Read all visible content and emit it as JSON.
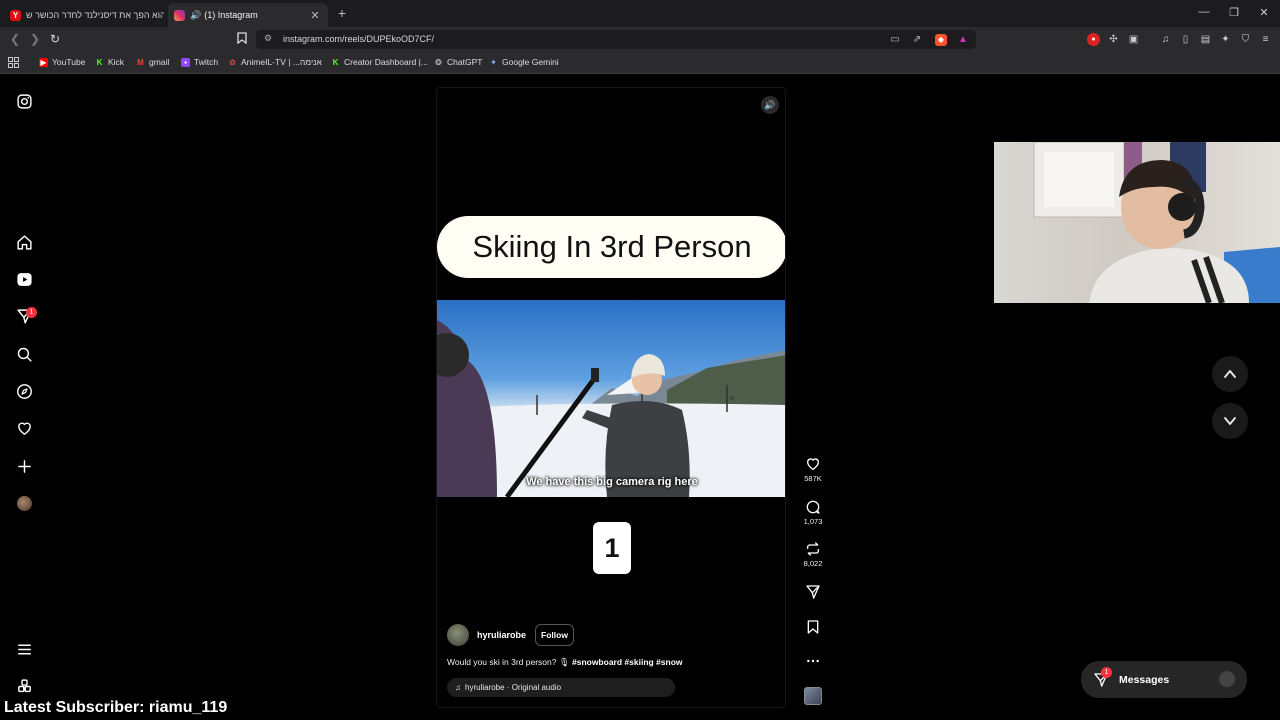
{
  "browser": {
    "tabs": [
      {
        "title": "הוא הפך את דיסנילנד לחדר הכושר ש...",
        "favicon": "yandex-icon",
        "active": false
      },
      {
        "title": "(1) Instagram",
        "favicon": "instagram-icon",
        "active": true,
        "audio": true
      }
    ],
    "url": "instagram.com/reels/DUPEkoOD7CF/",
    "bookmarks": [
      {
        "label": "YouTube",
        "icon": "youtube-icon",
        "color": "#ff0000"
      },
      {
        "label": "Kick",
        "icon": "kick-icon",
        "color": "#53fc18"
      },
      {
        "label": "gmail",
        "icon": "gmail-icon",
        "color": "#ea4335"
      },
      {
        "label": "Twitch",
        "icon": "twitch-icon",
        "color": "#9146ff"
      },
      {
        "label": "AnimeIL-TV | ...אנימה",
        "icon": "animeil-icon",
        "color": "#c0392b"
      },
      {
        "label": "Creator Dashboard |...",
        "icon": "kick-icon",
        "color": "#53fc18"
      },
      {
        "label": "ChatGPT",
        "icon": "chatgpt-icon",
        "color": "#cccccc"
      },
      {
        "label": "Google Gemini",
        "icon": "gemini-icon",
        "color": "#8ab4f8"
      }
    ]
  },
  "nav": {
    "notifications_badge": "1"
  },
  "reel": {
    "overlay_title": "Skiing In 3rd Person",
    "video_caption": "We have this big camera rig here",
    "number_card": "1",
    "author": "hyruliarobe",
    "follow_label": "Follow",
    "description_text": "Would you ski in 3rd person? 🎙 ",
    "hashtags": "#snowboard #skiing #snow",
    "audio": "hyruliarobe · Original audio"
  },
  "actions": {
    "likes": "587K",
    "comments": "1,073",
    "reposts": "8,022"
  },
  "messages": {
    "label": "Messages",
    "badge": "1"
  },
  "stream_overlay": {
    "latest_subscriber": "Latest Subscriber: riamu_119"
  },
  "colors": {
    "accent_badge": "#ff3040",
    "background": "#000000"
  }
}
